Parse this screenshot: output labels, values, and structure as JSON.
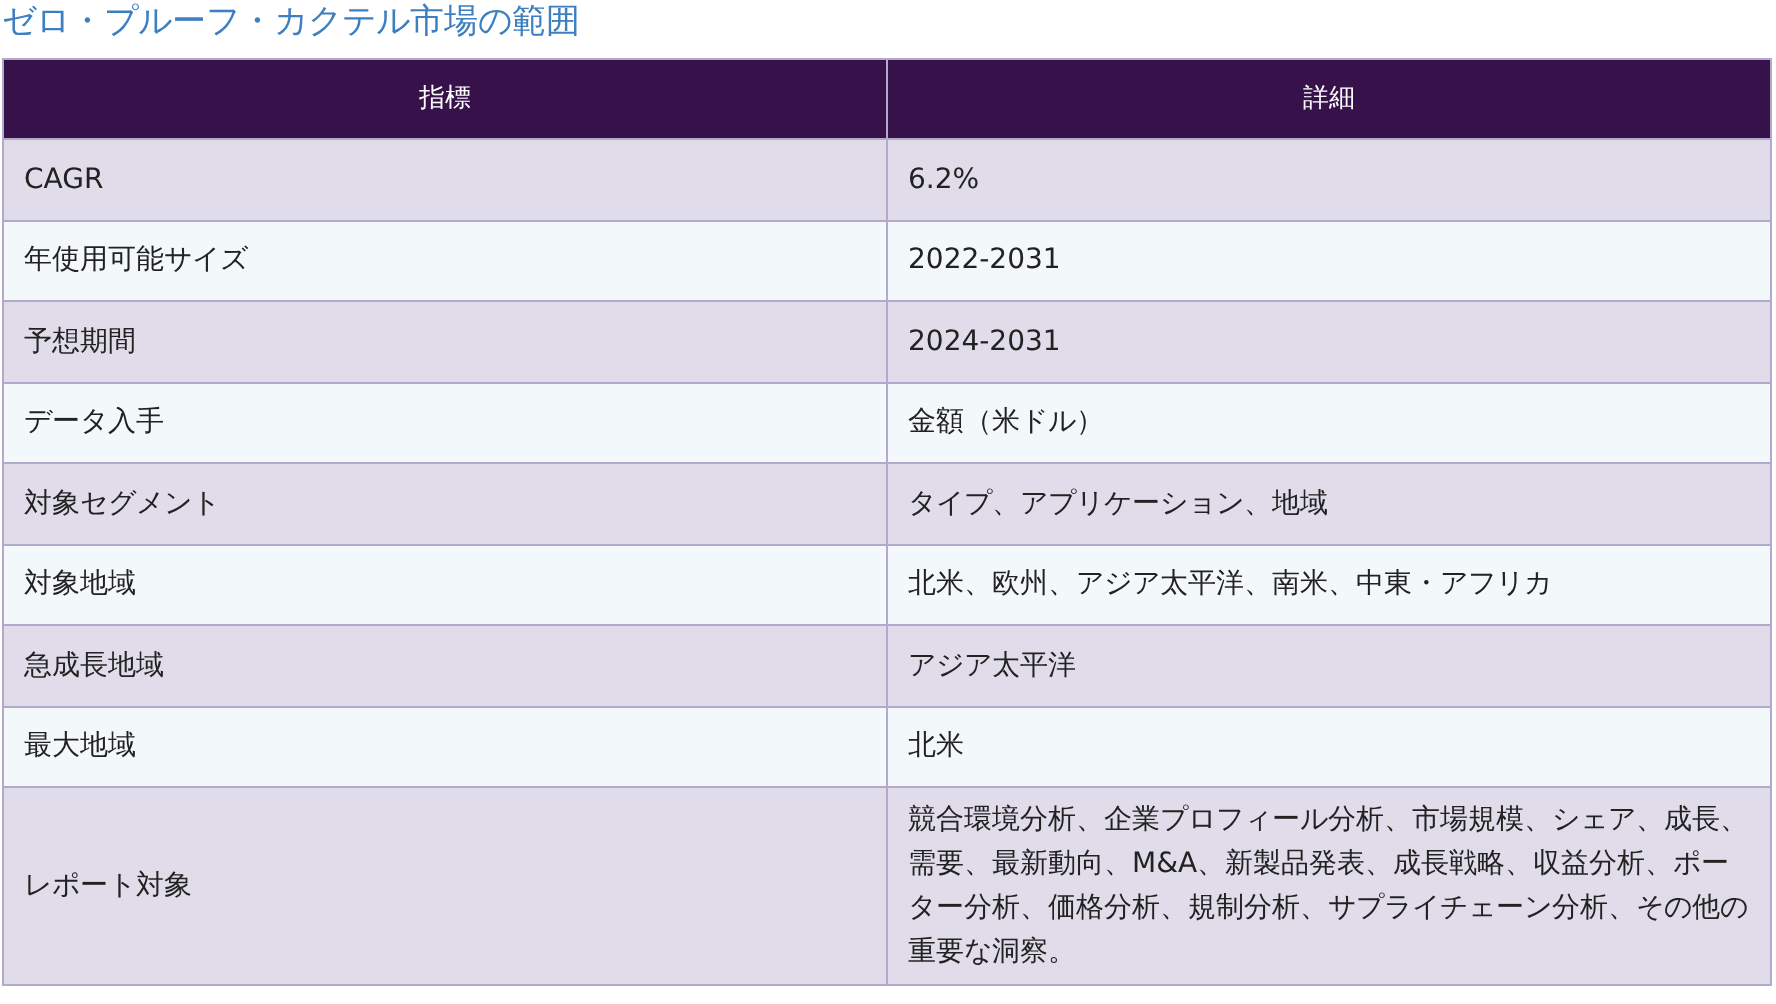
{
  "title": "ゼロ・プルーフ・カクテル市場の範囲",
  "table": {
    "columns": [
      "指標",
      "詳細"
    ],
    "rows": [
      [
        "CAGR",
        "6.2%"
      ],
      [
        "年使用可能サイズ",
        "2022-2031"
      ],
      [
        "予想期間",
        "2024-2031"
      ],
      [
        "データ入手",
        "金額（米ドル）"
      ],
      [
        "対象セグメント",
        "タイプ、アプリケーション、地域"
      ],
      [
        "対象地域",
        "北米、欧州、アジア太平洋、南米、中東・アフリカ"
      ],
      [
        "急成長地域",
        "アジア太平洋"
      ],
      [
        "最大地域",
        "北米"
      ],
      [
        "レポート対象",
        "競合環境分析、企業プロフィール分析、市場規模、シェア、成長、需要、最新動向、M&A、新製品発表、成長戦略、収益分析、ポーター分析、価格分析、規制分析、サプライチェーン分析、その他の重要な洞察。"
      ]
    ]
  }
}
